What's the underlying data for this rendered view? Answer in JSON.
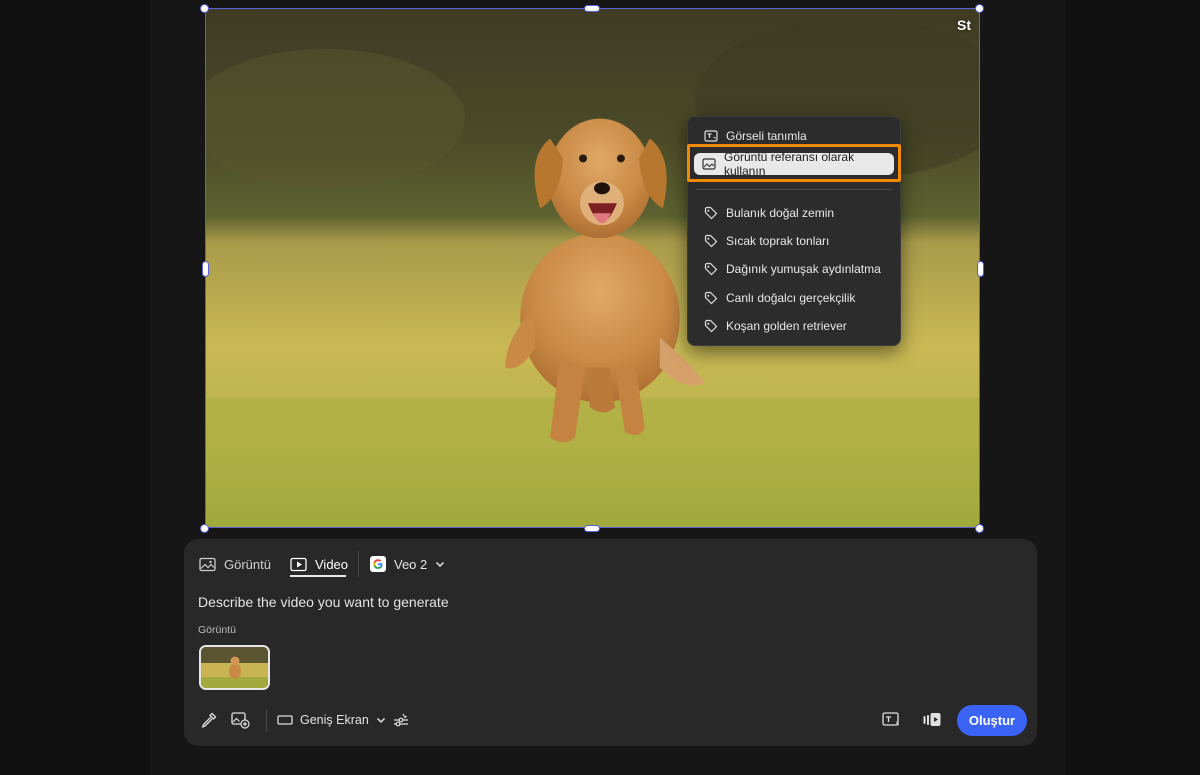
{
  "stock_badge": "St",
  "context_menu": {
    "items": [
      {
        "label": "Görseli tanımla",
        "icon": "describe-image-icon"
      },
      {
        "label": "Görüntü referansı olarak kullanın",
        "icon": "image-icon",
        "highlighted": true
      },
      {
        "label": "Bulanık doğal zemin",
        "icon": "tag-icon"
      },
      {
        "label": "Sıcak toprak tonları",
        "icon": "tag-icon"
      },
      {
        "label": "Dağınık yumuşak aydınlatma",
        "icon": "tag-icon"
      },
      {
        "label": "Canlı doğalcı gerçekçilik",
        "icon": "tag-icon"
      },
      {
        "label": "Koşan golden retriever",
        "icon": "tag-icon"
      }
    ],
    "highlight_color": "#f08a00"
  },
  "panel": {
    "tabs": [
      {
        "label": "Görüntü",
        "icon": "image-icon",
        "active": false
      },
      {
        "label": "Video",
        "icon": "video-play-icon",
        "active": true
      }
    ],
    "model": {
      "label": "Veo 2",
      "icon": "google-logo-icon"
    },
    "prompt_placeholder": "Describe the video you want to generate",
    "reference_label": "Görüntü",
    "aspect_ratio": "Geniş Ekran",
    "generate_label": "Oluştur",
    "accent_color": "#3b63f5"
  },
  "selection_color": "#5a5fd6"
}
